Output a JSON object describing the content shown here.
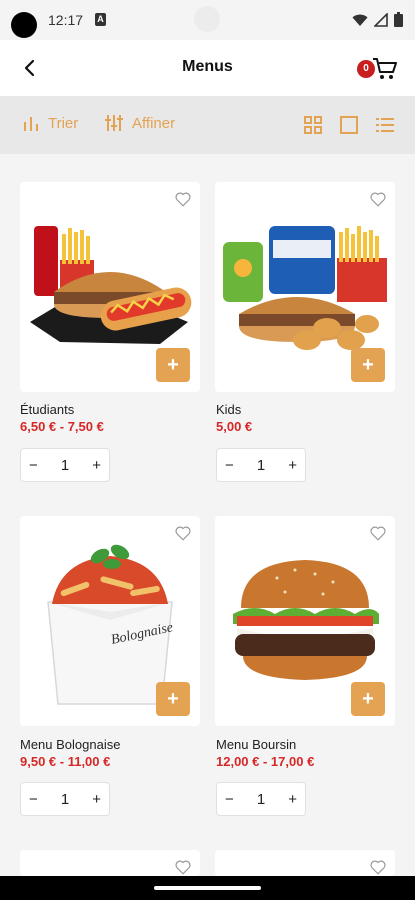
{
  "status": {
    "time": "12:17",
    "a_glyph": "A"
  },
  "header": {
    "title": "Menus",
    "cart_count": "0"
  },
  "filter": {
    "sort_label": "Trier",
    "refine_label": "Affiner",
    "accent": "#e3a352"
  },
  "products": [
    {
      "name": "Étudiants",
      "price": "6,50 € - 7,50 €",
      "qty": "1",
      "emoji": "🍔"
    },
    {
      "name": "Kids",
      "price": "5,00 €",
      "qty": "1",
      "emoji": "🍟"
    },
    {
      "name": "Menu Bolognaise",
      "price": "9,50 € - 11,00 €",
      "qty": "1",
      "emoji": "🍝"
    },
    {
      "name": "Menu Boursin",
      "price": "12,00 € - 17,00 €",
      "qty": "1",
      "emoji": "🍔"
    }
  ],
  "stepper": {
    "minus": "−",
    "plus": "+"
  },
  "add_label": "+"
}
